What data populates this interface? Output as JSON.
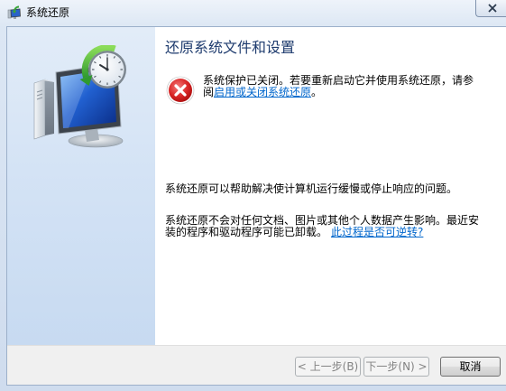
{
  "window": {
    "title": "系统还原",
    "title_icon": "system-restore-icon",
    "close_icon": "close-icon"
  },
  "illustration": {
    "icon": "computer-restore-illustration"
  },
  "content": {
    "heading": "还原系统文件和设置",
    "protection_notice": {
      "icon": "error-icon",
      "line1": "系统保护已关闭。若要重新启动它并使用系统还原，请参",
      "line2_prefix": "阅",
      "link": "启用或关闭系统还原",
      "line2_suffix": "。"
    },
    "paragraph1": "系统还原可以帮助解决使计算机运行缓慢或停止响应的问题。",
    "paragraph2": {
      "line1": "系统还原不会对任何文档、图片或其他个人数据产生影响。最近安",
      "line2": "装的程序和驱动程序可能已卸载。",
      "link": "此过程是否可逆转?"
    }
  },
  "buttons": {
    "back": {
      "label": "< 上一步(B)",
      "enabled": false
    },
    "next": {
      "label": "下一步(N) >",
      "enabled": false
    },
    "cancel": {
      "label": "取消",
      "enabled": true
    }
  },
  "colors": {
    "heading": "#1e3b6e",
    "link": "#0066cc",
    "error": "#d11a1a",
    "left_pane": "#d3e3f5",
    "button_bar": "#f0f0f0",
    "disabled_text": "#838383"
  }
}
